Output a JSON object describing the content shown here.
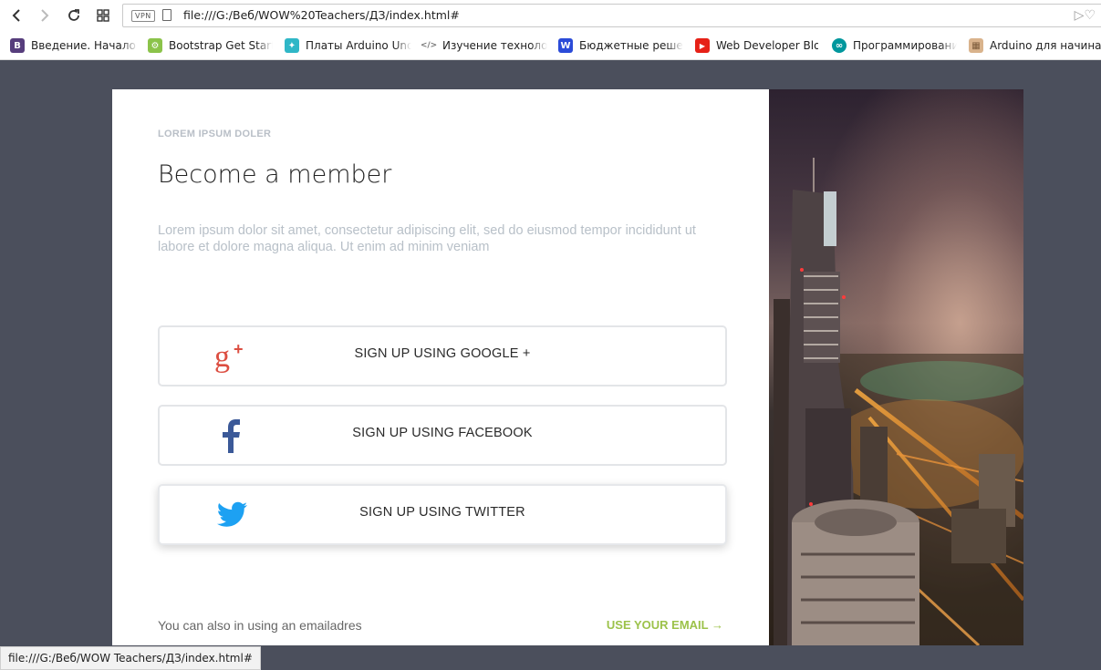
{
  "browser": {
    "url": "file:///G:/Веб/WOW%20Teachers/ДЗ/index.html#",
    "vpn_label": "VPN",
    "bookmarks": [
      {
        "label": "Введение. Начало ра",
        "color": "#563d7c",
        "glyph": "B"
      },
      {
        "label": "Bootstrap Get Startec",
        "color": "#8bc34a",
        "glyph": "⚙"
      },
      {
        "label": "Платы Arduino Uno:",
        "color": "#2fb7c7",
        "glyph": "✦"
      },
      {
        "label": "Изучение технологи",
        "color": "#888888",
        "glyph": "</>"
      },
      {
        "label": "Бюджетные решени",
        "color": "#2b4bd8",
        "glyph": "W"
      },
      {
        "label": "Web Developer Blog",
        "color": "#e62117",
        "glyph": "▶"
      },
      {
        "label": "Программирование",
        "color": "#00979d",
        "glyph": "∞"
      },
      {
        "label": "Arduino для начинаю",
        "color": "#d9b38c",
        "glyph": "▦"
      }
    ],
    "status_url": "file:///G:/Веб/WOW Teachers/ДЗ/index.html#"
  },
  "page": {
    "eyebrow": "LOREM IPSUM DOLER",
    "title": "Become a member",
    "intro": "Lorem ipsum dolor sit amet, consectetur adipiscing elit, sed do eiusmod tempor incididunt ut labore et dolore magna aliqua. Ut enim ad minim veniam",
    "social_buttons": [
      {
        "label": "SIGN UP USING GOOGLE +",
        "icon": "google-plus-icon",
        "color": "#dc4e41"
      },
      {
        "label": "SIGN UP USING FACEBOOK",
        "icon": "facebook-icon",
        "color": "#3b5998"
      },
      {
        "label": "SIGN UP USING TWITTER",
        "icon": "twitter-icon",
        "color": "#1da1f2"
      }
    ],
    "footer_text": "You can also in using an emailadres",
    "email_link": "USE YOUR EMAIL →",
    "accent_color": "#9cc24a",
    "background_color": "#4b4f5c"
  }
}
